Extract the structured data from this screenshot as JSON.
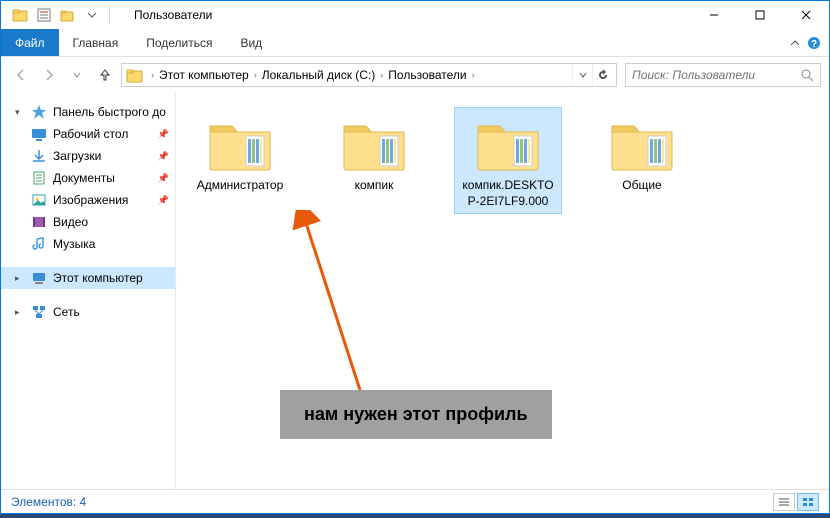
{
  "window": {
    "title": "Пользователи",
    "minimize": "—",
    "maximize": "☐",
    "close": "✕"
  },
  "ribbon": {
    "file": "Файл",
    "home": "Главная",
    "share": "Поделиться",
    "view": "Вид"
  },
  "breadcrumbs": [
    "Этот компьютер",
    "Локальный диск (C:)",
    "Пользователи"
  ],
  "search": {
    "placeholder": "Поиск: Пользователи"
  },
  "sidebar": {
    "quick": {
      "head": "Панель быстрого до",
      "items": [
        "Рабочий стол",
        "Загрузки",
        "Документы",
        "Изображения",
        "Видео",
        "Музыка"
      ]
    },
    "thispc": "Этот компьютер",
    "network": "Сеть"
  },
  "folders": [
    {
      "name": "Администратор",
      "selected": false
    },
    {
      "name": "компик",
      "selected": false
    },
    {
      "name": "компик.DESKTOP-2EI7LF9.000",
      "selected": true
    },
    {
      "name": "Общие",
      "selected": false
    }
  ],
  "status": {
    "text": "Элементов: 4"
  },
  "annotation": {
    "text": "нам нужен этот профиль"
  }
}
